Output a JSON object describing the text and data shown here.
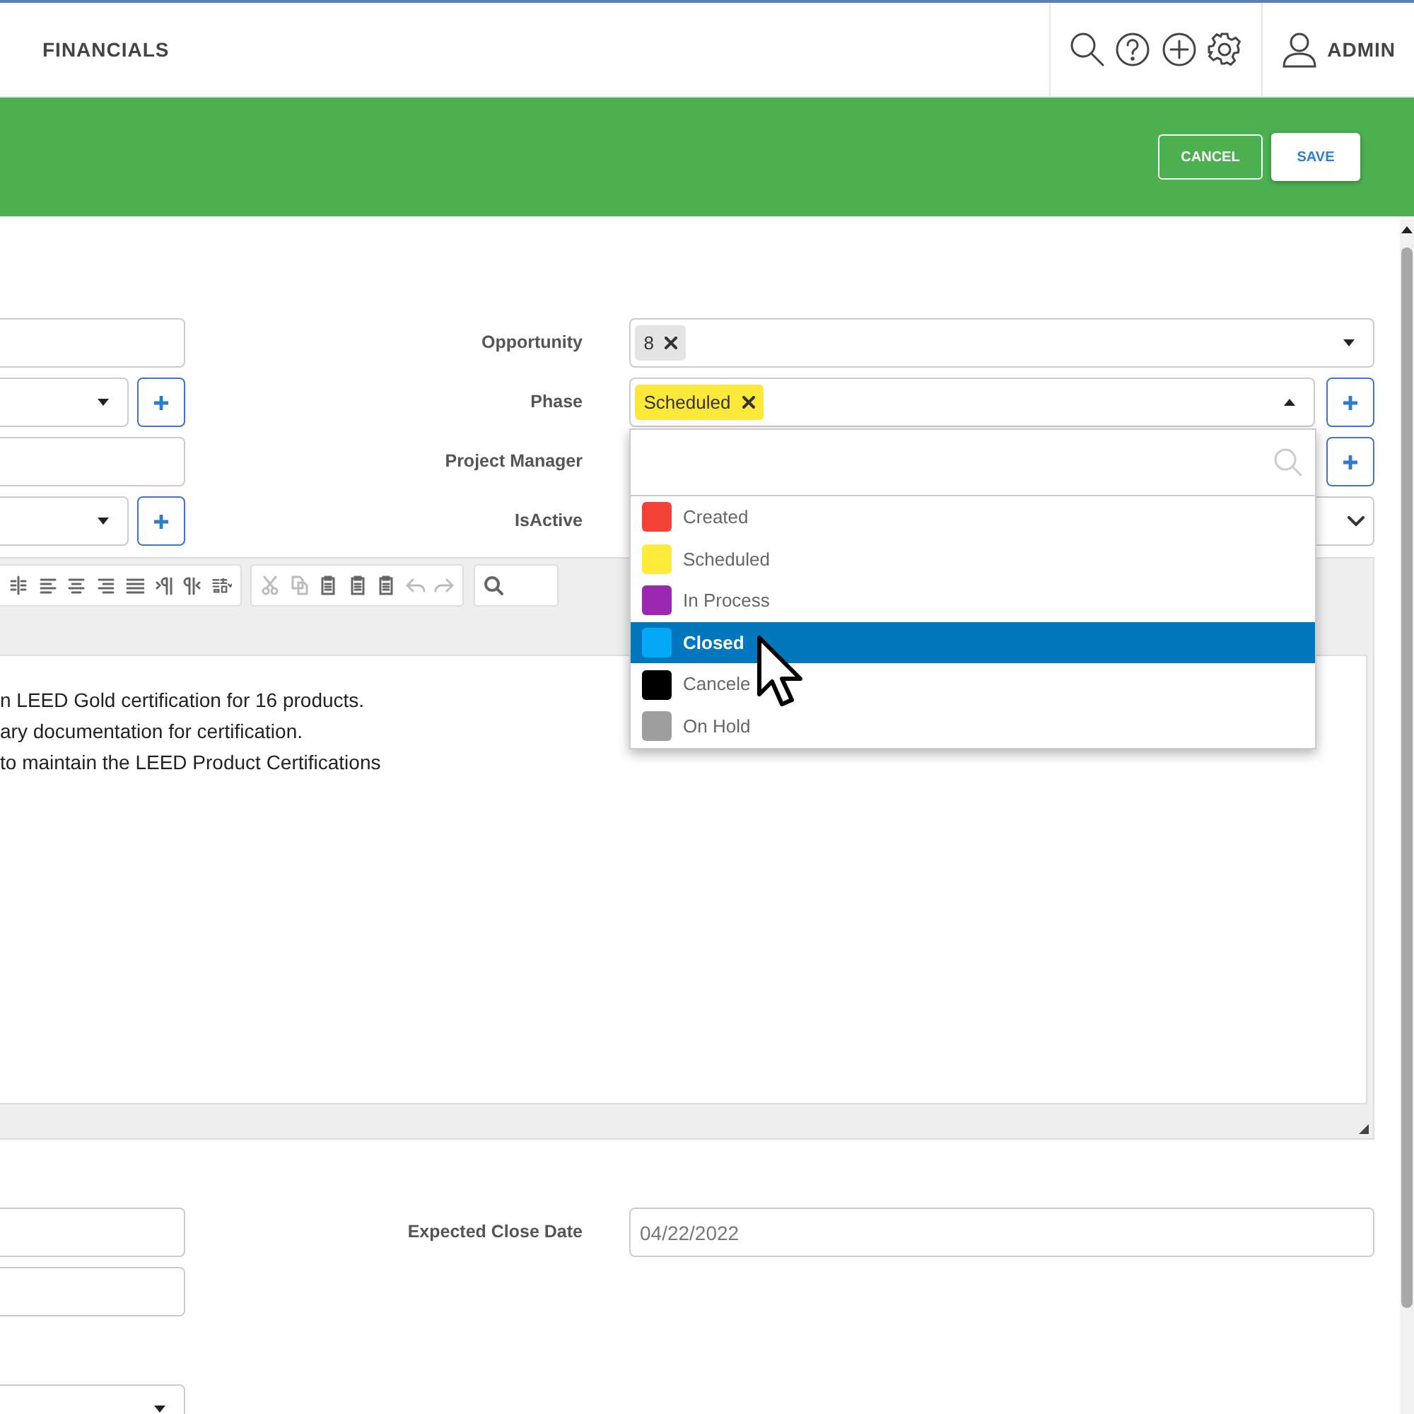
{
  "header": {
    "title": "FINANCIALS",
    "user": "ADMIN"
  },
  "action_bar": {
    "buttons": [
      {
        "label": "CANCEL",
        "kind": "outline"
      },
      {
        "label": "SAVE",
        "kind": "solid"
      }
    ]
  },
  "form_rows": [
    {
      "label": "Opportunity",
      "left_field": {
        "kind": "text"
      },
      "field": {
        "kind": "tags",
        "tags": [
          {
            "text": "8",
            "color": "#e4e4e4"
          }
        ],
        "open": false,
        "add": false
      }
    },
    {
      "label": "Phase",
      "left_field": {
        "kind": "select_add"
      },
      "field": {
        "kind": "tags",
        "tags": [
          {
            "text": "Scheduled",
            "color": "#fbe83b"
          }
        ],
        "open": true,
        "add": true
      }
    },
    {
      "label": "Project Manager",
      "left_field": {
        "kind": "text"
      },
      "field": {
        "kind": "hidden",
        "add": true
      }
    },
    {
      "label": "IsActive",
      "left_field": {
        "kind": "select_add"
      },
      "field": {
        "kind": "select",
        "add": false
      }
    }
  ],
  "phase_dropdown": {
    "options": [
      {
        "label": "Created",
        "color": "#f44336",
        "selected": false
      },
      {
        "label": "Scheduled",
        "color": "#ffeb3b",
        "selected": false
      },
      {
        "label": "In Process",
        "color": "#9c27b0",
        "selected": false
      },
      {
        "label": "Closed",
        "color": "#03a9f4",
        "selected": true
      },
      {
        "label": "Cancele",
        "color": "#000000",
        "selected": false
      },
      {
        "label": "On Hold",
        "color": "#9e9e9e",
        "selected": false
      }
    ]
  },
  "editor": {
    "lines": [
      "n LEED Gold certification for 16 products.",
      "ary documentation for certification.",
      " to maintain the LEED Product Certifications"
    ]
  },
  "bottom_rows": [
    {
      "label": "Expected Close Date",
      "value": "04/22/2022"
    }
  ]
}
